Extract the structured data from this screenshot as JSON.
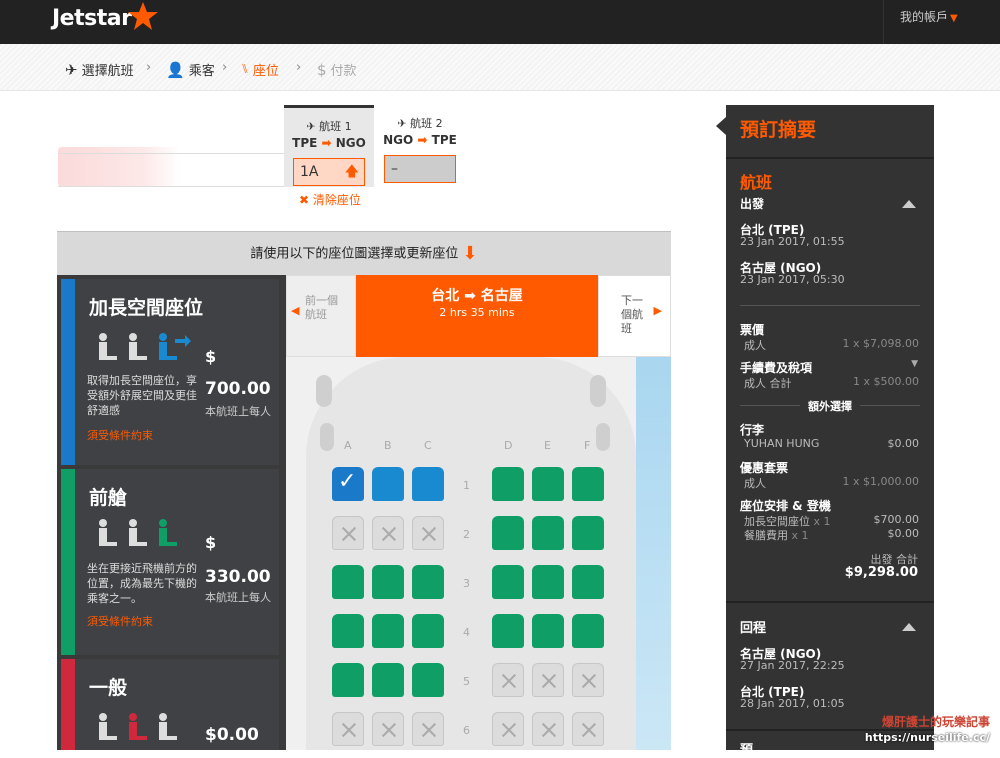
{
  "brand": {
    "name": "Jetstar"
  },
  "account": {
    "label": "我的帳戶"
  },
  "breadcrumb": [
    {
      "label": "選擇航班",
      "icon": "plane-icon"
    },
    {
      "label": "乘客",
      "icon": "person-icon"
    },
    {
      "label": "座位",
      "icon": "seat-icon"
    },
    {
      "label": "付款",
      "icon": "dollar-icon"
    }
  ],
  "flights": [
    {
      "label": "航班 1",
      "from": "TPE",
      "to": "NGO",
      "seat": "1A"
    },
    {
      "label": "航班 2",
      "from": "NGO",
      "to": "TPE",
      "seat": "–"
    }
  ],
  "clear_seat": "清除座位",
  "instruction": "請使用以下的座位圖選擇或更新座位",
  "categories": [
    {
      "title": "加長空間座位",
      "desc": "取得加長空間座位，享受額外舒展空間及更佳舒適感",
      "cond": "須受條件約束",
      "dollar": "$",
      "price": "700.00",
      "per": "本航班上每人",
      "color": "#1a7ac9"
    },
    {
      "title": "前艙",
      "desc": "坐在更接近飛機前方的位置，成為最先下機的乘客之一。",
      "cond": "須受條件約束",
      "dollar": "$",
      "price": "330.00",
      "per": "本航班上每人",
      "color": "#0e9e66"
    },
    {
      "title": "一般",
      "price": "$0.00",
      "color": "#d0283c"
    }
  ],
  "seatmap": {
    "prev": "前一個航班",
    "next": "下一個航班",
    "from": "台北",
    "to": "名古屋",
    "duration": "2 hrs 35 mins",
    "cols_left": [
      "A",
      "B",
      "C"
    ],
    "cols_right": [
      "D",
      "E",
      "F"
    ],
    "rows": [
      {
        "num": "1",
        "seats": [
          "sel",
          "blue",
          "blue",
          "green",
          "green",
          "green"
        ]
      },
      {
        "num": "2",
        "seats": [
          "x",
          "x",
          "x",
          "green",
          "green",
          "green"
        ]
      },
      {
        "num": "3",
        "seats": [
          "green",
          "green",
          "green",
          "green",
          "green",
          "green"
        ]
      },
      {
        "num": "4",
        "seats": [
          "green",
          "green",
          "green",
          "green",
          "green",
          "green"
        ]
      },
      {
        "num": "5",
        "seats": [
          "green",
          "green",
          "green",
          "x",
          "x",
          "x"
        ]
      },
      {
        "num": "6",
        "seats": [
          "x",
          "x",
          "x",
          "x",
          "x",
          "x"
        ]
      }
    ]
  },
  "summary": {
    "title": "預訂摘要",
    "flight_heading": "航班",
    "depart_label": "出發",
    "dep_from": "台北 (TPE)",
    "dep_from_time": "23 Jan 2017, 01:55",
    "dep_to": "名古屋 (NGO)",
    "dep_to_time": "23 Jan 2017, 05:30",
    "fare_label": "票價",
    "fare_who": "成人",
    "fare_q": "1 x $7,098.00",
    "tax_label": "手續費及稅項",
    "tax_who": "成人 合計",
    "tax_q": "1 x $500.00",
    "extras_label": "額外選擇",
    "bag_label": "行李",
    "bag_who": "YUHAN HUNG",
    "bag_amt": "$0.00",
    "pkg_label": "優惠套票",
    "pkg_who": "成人",
    "pkg_q": "1 x $1,000.00",
    "seatmeal_label": "座位安排 & 登機",
    "seat_item": "加長空間座位",
    "seat_q": "x 1",
    "seat_amt": "$700.00",
    "meal_item": "餐膳費用",
    "meal_q": "x 1",
    "meal_amt": "$0.00",
    "dep_total_label": "出發 合計",
    "dep_total": "$9,298.00",
    "return_label": "回程",
    "ret_from": "名古屋 (NGO)",
    "ret_from_time": "27 Jan 2017, 22:25",
    "ret_to": "台北 (TPE)",
    "ret_to_time": "28 Jan 2017, 01:05",
    "bottom_label": "預"
  },
  "watermark": {
    "line1": "爆肝護士的玩樂記事",
    "line2": "https://nurseilife.cc/"
  },
  "colors": {
    "accent": "#ff5a00",
    "dark": "#222222",
    "summary_bg": "#333333"
  }
}
